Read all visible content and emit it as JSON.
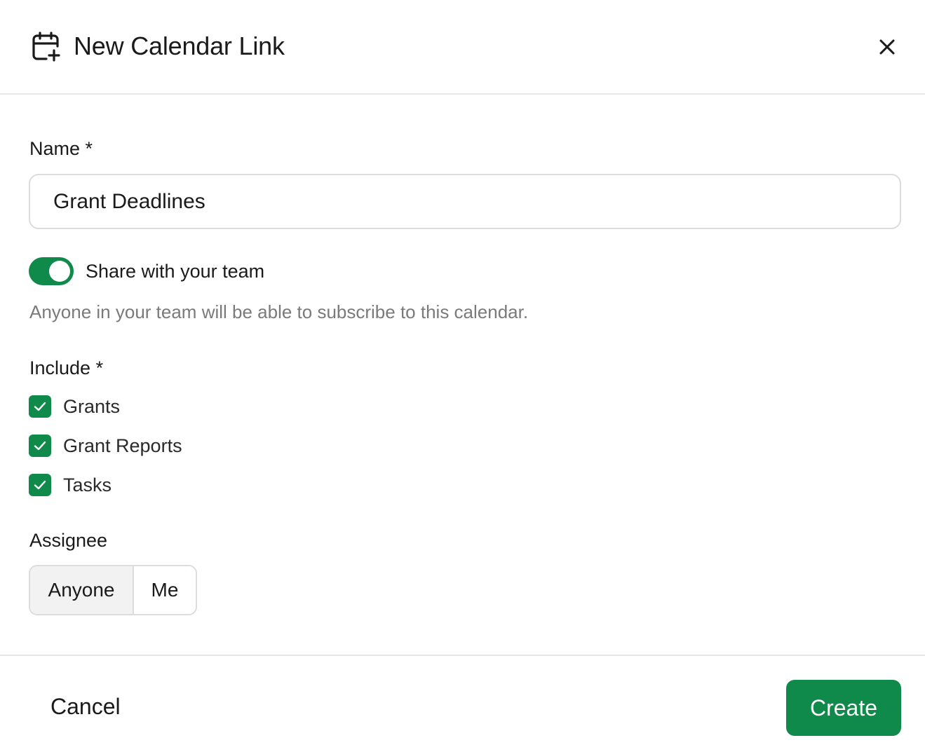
{
  "header": {
    "title": "New Calendar Link",
    "icon": "calendar-plus-icon",
    "close_icon": "close-icon"
  },
  "form": {
    "name_label": "Name *",
    "name_value": "Grant Deadlines",
    "share_toggle_on": true,
    "share_label": "Share with your team",
    "share_help": "Anyone in your team will be able to subscribe to this calendar.",
    "include_label": "Include *",
    "include_options": [
      {
        "label": "Grants",
        "checked": true
      },
      {
        "label": "Grant Reports",
        "checked": true
      },
      {
        "label": "Tasks",
        "checked": true
      }
    ],
    "assignee_label": "Assignee",
    "assignee_options": [
      "Anyone",
      "Me"
    ],
    "assignee_selected": "Anyone"
  },
  "footer": {
    "cancel_label": "Cancel",
    "create_label": "Create"
  },
  "colors": {
    "accent": "#0f8a4a",
    "border": "#dcdcdc",
    "muted_text": "#7a7a7a",
    "selected_segment": "#f2f2f2"
  }
}
